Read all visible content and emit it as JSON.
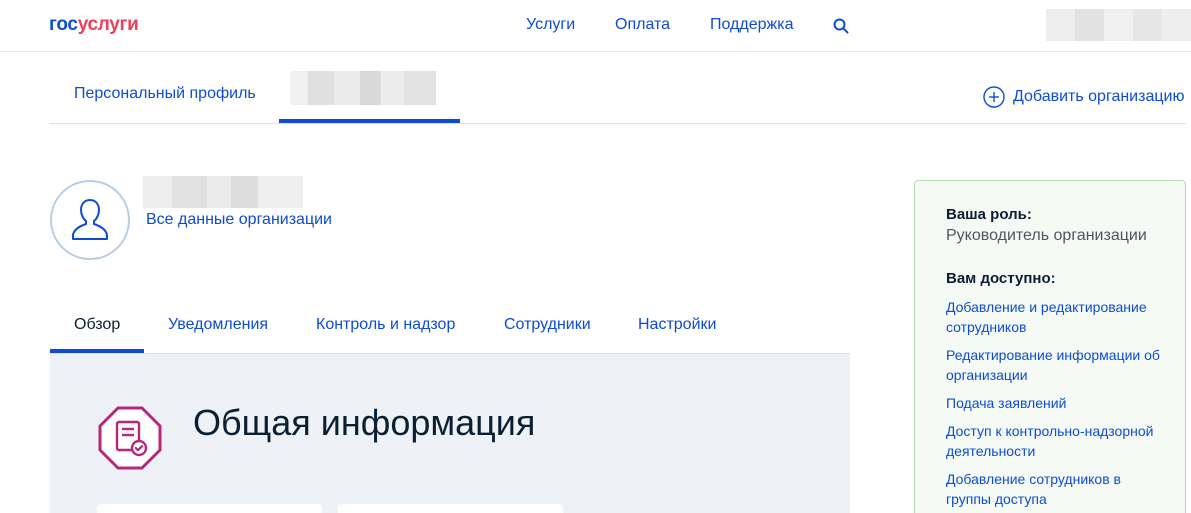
{
  "header": {
    "logo_part1": "гос",
    "logo_part2": "услуги",
    "nav": [
      "Услуги",
      "Оплата",
      "Поддержка"
    ],
    "search_icon": "search-icon"
  },
  "org_tabs": {
    "personal": "Персональный профиль",
    "add_org": "Добавить организацию"
  },
  "org": {
    "all_data": "Все данные организации"
  },
  "section_tabs": [
    "Обзор",
    "Уведомления",
    "Контроль и надзор",
    "Сотрудники",
    "Настройки"
  ],
  "overview": {
    "title": "Общая информация"
  },
  "role_panel": {
    "role_label": "Ваша роль:",
    "role_value": "Руководитель организации",
    "available_label": "Вам доступно:",
    "permissions": [
      "Добавление и редактирование сотрудников",
      "Редактирование информации об организации",
      "Подача заявлений",
      "Доступ к контрольно-надзорной деятельности",
      "Добавление сотрудников в группы доступа"
    ]
  },
  "colors": {
    "brand_blue": "#0d4cd3",
    "brand_red": "#ee3f58",
    "overview_icon": "#b4277a"
  }
}
